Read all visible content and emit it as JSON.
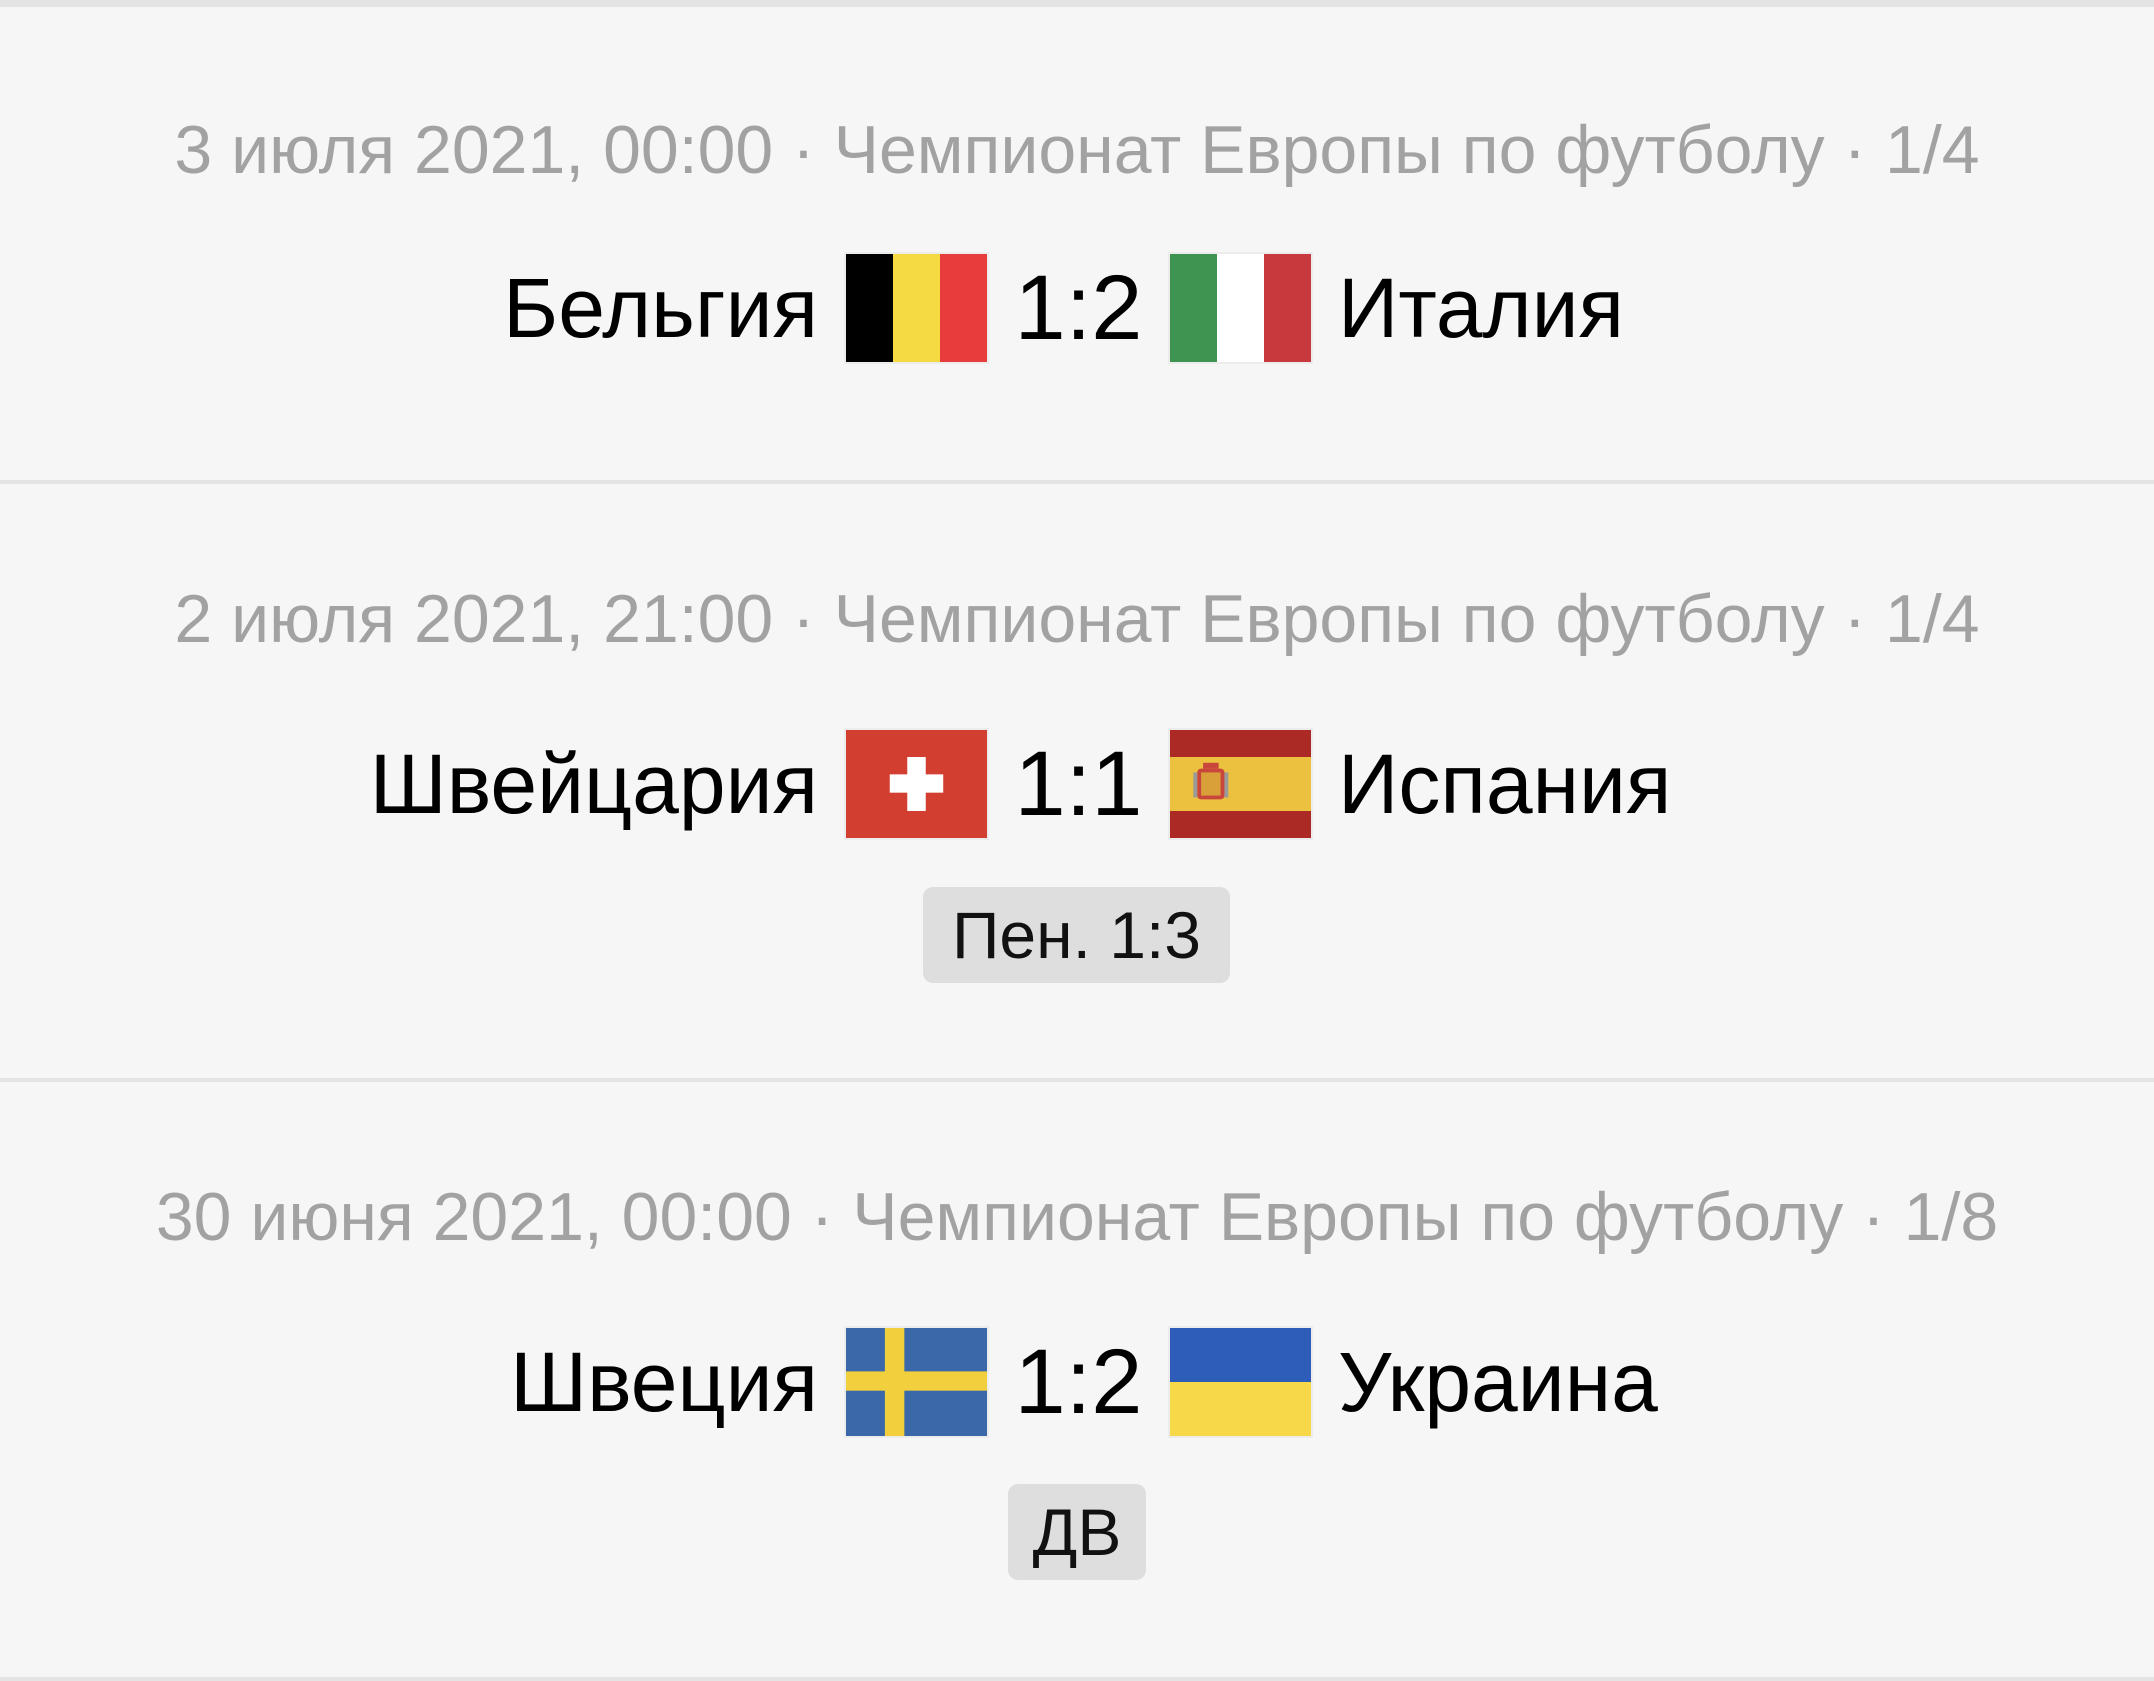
{
  "matches": [
    {
      "meta": "3 июля 2021, 00:00 · Чемпионат Европы по футболу · 1/4",
      "home_team": "Бельгия",
      "home_flag": "belgium-flag",
      "score": "1:2",
      "away_team": "Италия",
      "away_flag": "italy-flag",
      "note": ""
    },
    {
      "meta": "2 июля 2021, 21:00 · Чемпионат Европы по футболу · 1/4",
      "home_team": "Швейцария",
      "home_flag": "switzerland-flag",
      "score": "1:1",
      "away_team": "Испания",
      "away_flag": "spain-flag",
      "note": "Пен. 1:3"
    },
    {
      "meta": "30 июня 2021, 00:00 · Чемпионат Европы по футболу · 1/8",
      "home_team": "Швеция",
      "home_flag": "sweden-flag",
      "score": "1:2",
      "away_team": "Украина",
      "away_flag": "ukraine-flag",
      "note": "ДВ"
    }
  ],
  "colors": {
    "background": "#f6f6f6",
    "divider": "#e4e4e4",
    "meta_text": "#a2a2a2",
    "badge_bg": "#dedede"
  }
}
